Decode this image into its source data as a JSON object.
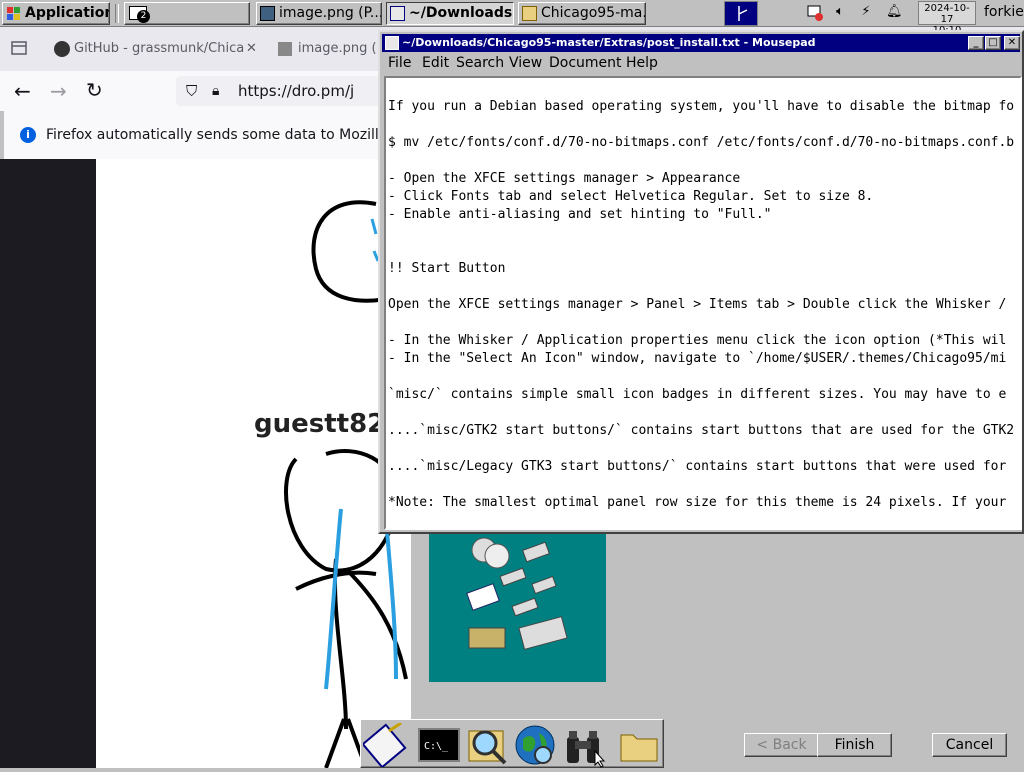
{
  "taskbar": {
    "apps_label": "Applications",
    "workspace_badge": "2",
    "windows": [
      {
        "label": "image.png (P..."
      },
      {
        "label": "~/Downloads..."
      },
      {
        "label": "Chicago95-ma..."
      }
    ],
    "clock_date": "2024-10-17",
    "clock_time": "10:10",
    "user": "forkie"
  },
  "firefox": {
    "tabs": [
      {
        "label": "GitHub - grassmunk/Chica",
        "icon": "github-icon"
      },
      {
        "label": "image.png (",
        "icon": "image-icon"
      }
    ],
    "url": "https://dro.pm/j",
    "notice": "Firefox automatically sends some data to Mozilla so th",
    "drawing_text": "guestt82"
  },
  "wizard": {
    "back_label": "< Back",
    "finish_label": "Finish",
    "cancel_label": "Cancel"
  },
  "mousepad": {
    "title": "~/Downloads/Chicago95-master/Extras/post_install.txt - Mousepad",
    "menu": [
      "File",
      "Edit",
      "Search",
      "View",
      "Document",
      "Help"
    ],
    "lines": [
      "",
      "If you run a Debian based operating system, you'll have to disable the bitmap fo",
      "",
      "$ mv /etc/fonts/conf.d/70-no-bitmaps.conf /etc/fonts/conf.d/70-no-bitmaps.conf.b",
      "",
      "- Open the XFCE settings manager > Appearance",
      "- Click Fonts tab and select Helvetica Regular. Set to size 8.",
      "- Enable anti-aliasing and set hinting to \"Full.\"",
      "",
      "",
      "!! Start Button",
      "",
      "Open the XFCE settings manager > Panel > Items tab > Double click the Whisker / ",
      "",
      "- In the Whisker / Application properties menu click the icon option (*This wil",
      "- In the \"Select An Icon\" window, navigate to `/home/$USER/.themes/Chicago95/mi",
      "",
      "`misc/` contains simple small icon badges in different sizes. You may have to e",
      "",
      "....`misc/GTK2 start buttons/` contains start buttons that are used for the GTK2",
      "",
      "....`misc/Legacy GTK3 start buttons/` contains start buttons that were used for ",
      "",
      "*Note: The smallest optimal panel row size for this theme is 24 pixels. If your"
    ]
  },
  "dock": {
    "items": [
      "text-editor-icon",
      "terminal-icon",
      "search-icon",
      "web-browser-icon",
      "find-binoculars-icon",
      "folder-icon"
    ]
  }
}
